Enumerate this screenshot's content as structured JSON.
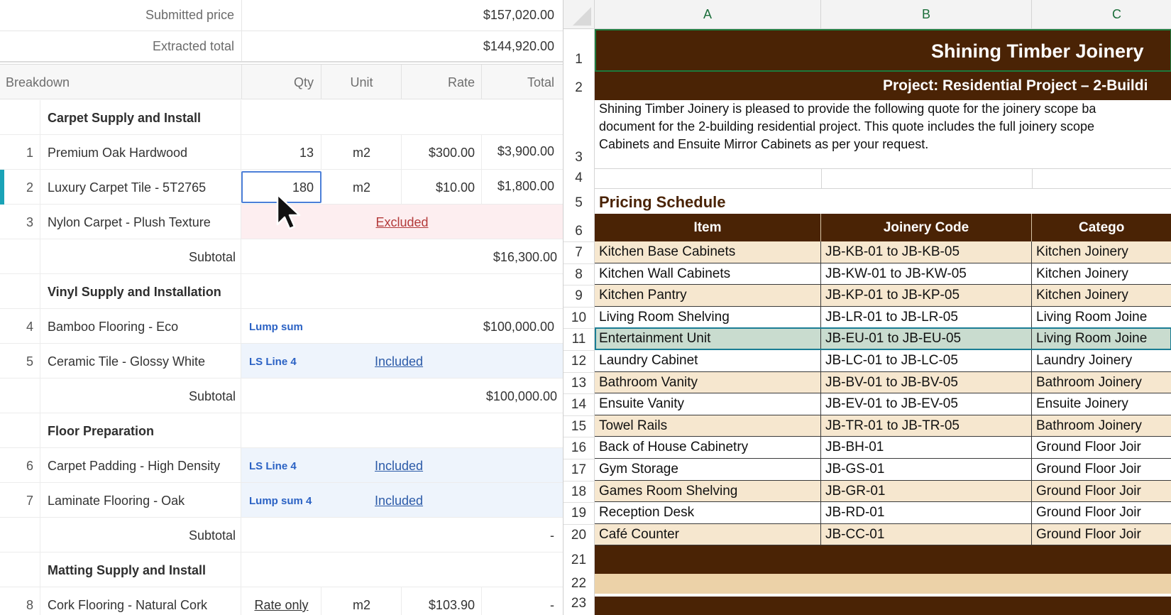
{
  "summary": {
    "submitted_label": "Submitted price",
    "submitted_value": "$157,020.00",
    "extracted_label": "Extracted total",
    "extracted_value": "$144,920.00"
  },
  "table_header": {
    "breakdown": "Breakdown",
    "qty": "Qty",
    "unit": "Unit",
    "rate": "Rate",
    "total": "Total"
  },
  "sections": {
    "carpet": "Carpet Supply and Install",
    "vinyl": "Vinyl Supply and Installation",
    "floor": "Floor Preparation",
    "matting": "Matting Supply and Install"
  },
  "items": [
    {
      "num": "1",
      "name": "Premium Oak Hardwood",
      "qty": "13",
      "unit": "m2",
      "rate": "$300.00",
      "total": "$3,900.00"
    },
    {
      "num": "2",
      "name": "Luxury Carpet Tile - 5T2765",
      "qty": "180",
      "unit": "m2",
      "rate": "$10.00",
      "total": "$1,800.00"
    },
    {
      "num": "3",
      "name": "Nylon Carpet - Plush Texture",
      "status": "Excluded"
    },
    {
      "num": "4",
      "name": "Bamboo Flooring - Eco",
      "tag": "Lump sum",
      "total": "$100,000.00"
    },
    {
      "num": "5",
      "name": "Ceramic Tile - Glossy White",
      "tag": "LS Line 4",
      "status": "Included"
    },
    {
      "num": "6",
      "name": "Carpet Padding - High Density",
      "tag": "LS Line 4",
      "status": "Included"
    },
    {
      "num": "7",
      "name": "Laminate Flooring - Oak",
      "tag": "Lump sum 4",
      "status": "Included"
    },
    {
      "num": "8",
      "name": "Cork Flooring - Natural Cork",
      "tag": "Rate only",
      "unit": "m2",
      "rate": "$103.90",
      "total": "-"
    }
  ],
  "subtotals": {
    "label": "Subtotal",
    "carpet": "$16,300.00",
    "vinyl": "$100,000.00",
    "floor": "-"
  },
  "sheet": {
    "columns": [
      "A",
      "B",
      "C"
    ],
    "title": "Shining Timber Joinery",
    "project": "Project: Residential Project – 2-Buildi",
    "intro_lines": [
      "Shining Timber Joinery is pleased to provide the following quote for the joinery scope ba",
      "document for the 2-building residential project. This quote includes the full joinery scope",
      "Cabinets and Ensuite Mirror Cabinets as per your request."
    ],
    "pricing_heading": "Pricing Schedule",
    "headers": [
      "Item",
      "Joinery Code",
      "Catego"
    ],
    "rows": [
      {
        "r": "7",
        "item": "Kitchen Base Cabinets",
        "code": "JB-KB-01 to JB-KB-05",
        "cat": "Kitchen Joinery"
      },
      {
        "r": "8",
        "item": "Kitchen Wall Cabinets",
        "code": "JB-KW-01 to JB-KW-05",
        "cat": "Kitchen Joinery"
      },
      {
        "r": "9",
        "item": "Kitchen Pantry",
        "code": "JB-KP-01 to JB-KP-05",
        "cat": "Kitchen Joinery"
      },
      {
        "r": "10",
        "item": "Living Room Shelving",
        "code": "JB-LR-01 to JB-LR-05",
        "cat": "Living Room Joine"
      },
      {
        "r": "11",
        "item": "Entertainment Unit",
        "code": "JB-EU-01 to JB-EU-05",
        "cat": "Living Room Joine"
      },
      {
        "r": "12",
        "item": "Laundry Cabinet",
        "code": "JB-LC-01 to JB-LC-05",
        "cat": "Laundry Joinery"
      },
      {
        "r": "13",
        "item": "Bathroom Vanity",
        "code": "JB-BV-01 to JB-BV-05",
        "cat": "Bathroom Joinery"
      },
      {
        "r": "14",
        "item": "Ensuite Vanity",
        "code": "JB-EV-01 to JB-EV-05",
        "cat": "Ensuite Joinery"
      },
      {
        "r": "15",
        "item": "Towel Rails",
        "code": "JB-TR-01 to JB-TR-05",
        "cat": "Bathroom Joinery"
      },
      {
        "r": "16",
        "item": "Back of House Cabinetry",
        "code": "JB-BH-01",
        "cat": "Ground Floor Joir"
      },
      {
        "r": "17",
        "item": "Gym Storage",
        "code": "JB-GS-01",
        "cat": "Ground Floor Joir"
      },
      {
        "r": "18",
        "item": "Games Room Shelving",
        "code": "JB-GR-01",
        "cat": "Ground Floor Joir"
      },
      {
        "r": "19",
        "item": "Reception Desk",
        "code": "JB-RD-01",
        "cat": "Ground Floor Joir"
      },
      {
        "r": "20",
        "item": "Café Counter",
        "code": "JB-CC-01",
        "cat": "Ground Floor Joir"
      }
    ],
    "row_numbers": [
      "1",
      "2",
      "3",
      "4",
      "5",
      "6",
      "21",
      "22",
      "23"
    ]
  },
  "colors": {
    "brown": "#4a2305",
    "tan": "#f6e7cf",
    "selection_teal": "#1aa3b7",
    "header_green": "#1b6e3a"
  }
}
